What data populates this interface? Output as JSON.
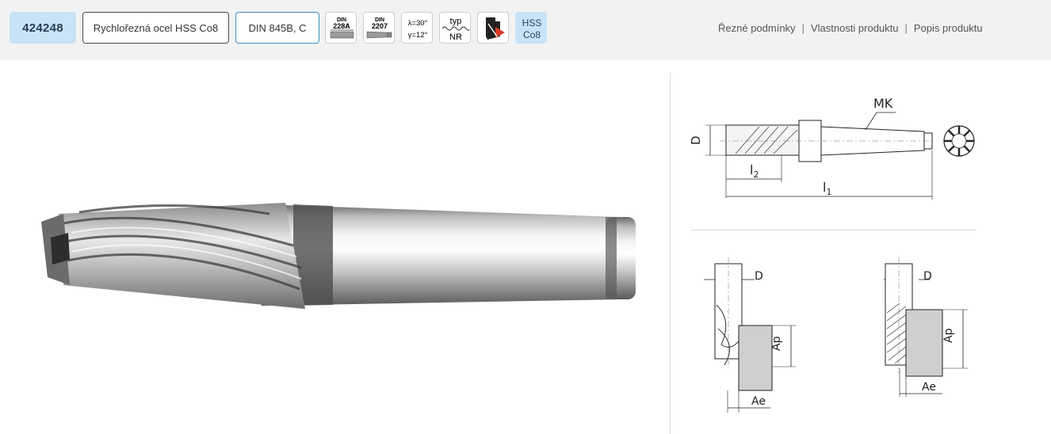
{
  "product": {
    "code": "424248",
    "material": "Rychlořezná ocel HSS Co8",
    "standard": "DIN 845B, C"
  },
  "icons": {
    "din228a": {
      "line1": "DIN",
      "line2": "228A"
    },
    "din2207": {
      "line1": "DIN",
      "line2": "2207"
    },
    "angles": {
      "lambda": "λ=30°",
      "gamma": "γ=12°"
    },
    "type": {
      "line1": "typ",
      "line2": "NR"
    },
    "hss": {
      "line1": "HSS",
      "line2": "Co8"
    }
  },
  "nav": {
    "cutting_conditions": "Řezné podmínky",
    "product_properties": "Vlastnosti produktu",
    "product_description": "Popis produktu",
    "separator": "|"
  },
  "drawing": {
    "mk": "MK",
    "d": "D",
    "l2": "l",
    "l2_sub": "2",
    "l1": "l",
    "l1_sub": "1",
    "ap": "Ap",
    "ae": "Ae"
  },
  "colors": {
    "code_badge_bg": "#c8e3f6",
    "topbar_bg": "#f2f2f2",
    "standard_border": "#3d8fc4",
    "hss_badge_bg": "#c8e3f6"
  }
}
